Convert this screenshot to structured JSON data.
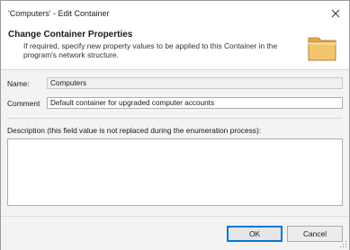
{
  "window": {
    "title": "'Computers' - Edit Container",
    "close_icon": "close-icon"
  },
  "header": {
    "title": "Change Container Properties",
    "description": "If required, specify new property values to be applied to this Container in the program's network structure.",
    "icon": "folder-icon"
  },
  "form": {
    "name_label": "Name:",
    "name_value": "Computers",
    "comment_label": "Comment",
    "comment_value": "Default container for upgraded computer accounts",
    "description_label": "Description (this field value is not replaced during the enumeration process):",
    "description_value": ""
  },
  "footer": {
    "ok_label": "OK",
    "cancel_label": "Cancel"
  },
  "colors": {
    "accent": "#0078d7",
    "content_bg": "#f3f3f3",
    "folder_body": "#f3c46e"
  }
}
